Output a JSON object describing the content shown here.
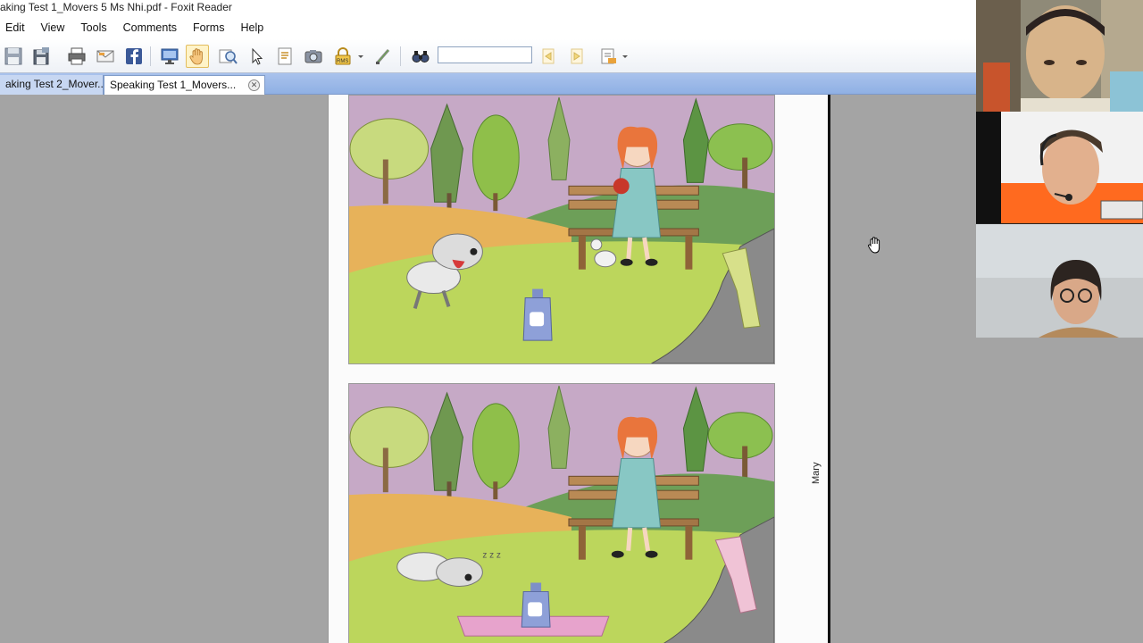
{
  "window": {
    "title": "aking Test 1_Movers 5 Ms Nhi.pdf - Foxit Reader"
  },
  "menu": {
    "items": [
      "Edit",
      "View",
      "Tools",
      "Comments",
      "Forms",
      "Help"
    ]
  },
  "toolbar": {
    "find_value": "",
    "icons": [
      "save-icon",
      "save-as-icon",
      "print-icon",
      "email-icon",
      "facebook-icon",
      "fullscreen-icon",
      "hand-tool-icon",
      "zoom-tool-icon",
      "select-tool-icon",
      "text-select-icon",
      "snapshot-icon",
      "rms-icon",
      "typewriter-icon",
      "find-icon",
      "previous-result-icon",
      "next-result-icon",
      "comment-icon"
    ]
  },
  "tabs": [
    {
      "label": "aking Test 2_Mover..."
    },
    {
      "label": "Speaking Test 1_Movers..."
    }
  ],
  "document": {
    "side_label": "Mary",
    "rms_label": "RMS"
  },
  "colors": {
    "sky": "#c6a9c6",
    "grass": "#bcd65c",
    "hill": "#6d9f58",
    "sand": "#e7b25a",
    "tab_bar": "#9db9e8",
    "viewer_bg": "#a4a4a4"
  }
}
